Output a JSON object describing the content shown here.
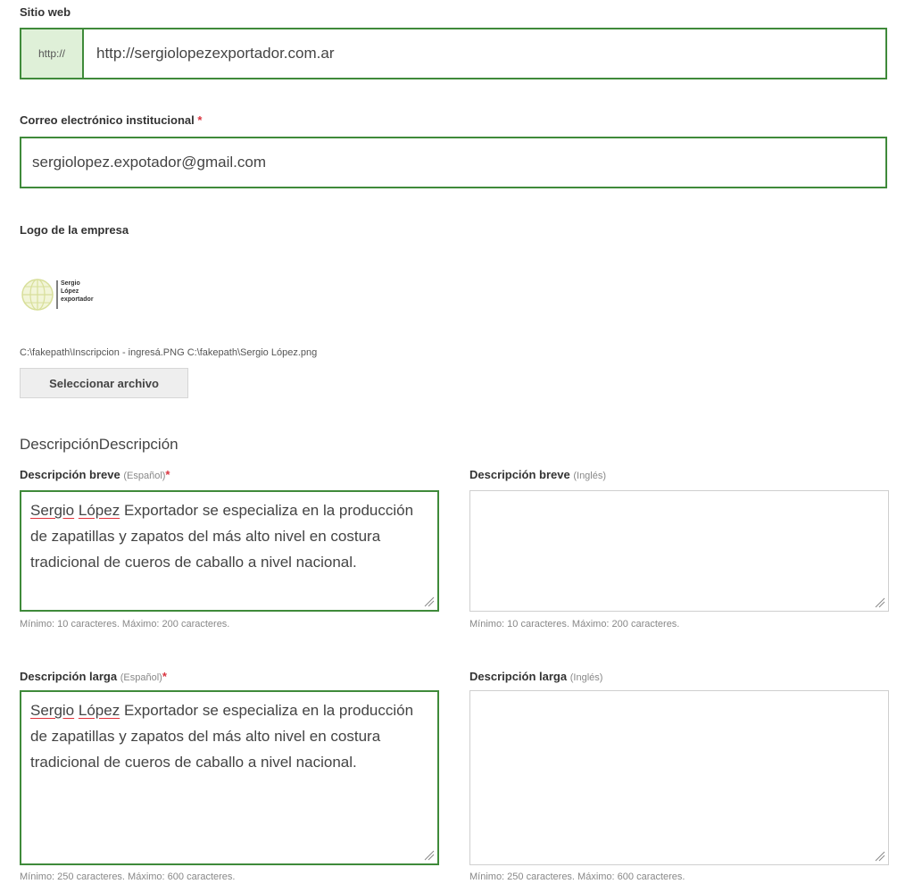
{
  "website": {
    "label": "Sitio web",
    "prefix": "http://",
    "value": "http://sergiolopezexportador.com.ar"
  },
  "email": {
    "label": "Correo electrónico institucional",
    "required_mark": "*",
    "value": "sergiolopez.expotador@gmail.com"
  },
  "logo": {
    "label": "Logo de la empresa",
    "brand_lines": [
      "Sergio",
      "López",
      "exportador"
    ],
    "file_paths": "C:\\fakepath\\Inscripcion - ingresá.PNG C:\\fakepath\\Sergio López.png",
    "select_button": "Seleccionar archivo"
  },
  "description": {
    "section_title": "DescripciónDescripción",
    "short_es": {
      "label": "Descripción breve",
      "lang": "(Español)",
      "required_mark": "*",
      "value_name1": "Sergio",
      "value_name2": "López",
      "value_rest": "Exportador se especializa en la producción de zapatillas y zapatos del más alto nivel en costura tradicional de cueros de caballo a nivel nacional.",
      "help": "Mínimo: 10 caracteres. Máximo: 200 caracteres."
    },
    "short_en": {
      "label": "Descripción breve",
      "lang": "(Inglés)",
      "value": "",
      "help": "Mínimo: 10 caracteres. Máximo: 200 caracteres."
    },
    "long_es": {
      "label": "Descripción larga",
      "lang": "(Español)",
      "required_mark": "*",
      "value_name1": "Sergio",
      "value_name2": "López",
      "value_rest": "Exportador se especializa en la producción de zapatillas y zapatos del más alto nivel en costura tradicional de cueros de caballo a nivel nacional.",
      "help": "Mínimo: 250 caracteres. Máximo: 600 caracteres."
    },
    "long_en": {
      "label": "Descripción larga",
      "lang": "(Inglés)",
      "value": "",
      "help": "Mínimo: 250 caracteres. Máximo: 600 caracteres."
    }
  },
  "colors": {
    "accent_border": "#3f8a3a",
    "addon_bg": "#dff0d8",
    "required": "#d9343f"
  }
}
